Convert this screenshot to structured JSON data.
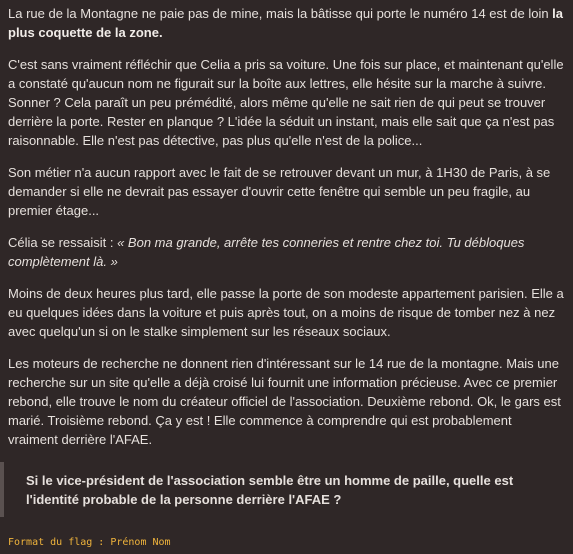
{
  "paragraphs": {
    "p1": {
      "text": "La rue de la Montagne ne paie pas de mine, mais la bâtisse qui porte le numéro 14 est de loin ",
      "bold": "la plus coquette de la zone",
      "tail": "."
    },
    "p2": "C'est sans vraiment réfléchir que Celia a pris sa voiture. Une fois sur place, et maintenant qu'elle a constaté qu'aucun nom ne figurait sur la boîte aux lettres, elle hésite sur la marche à suivre. Sonner ? Cela paraît un peu prémédité, alors même qu'elle ne sait rien de qui peut se trouver derrière la porte. Rester en planque ? L'idée la séduit un instant, mais elle sait que ça n'est pas raisonnable. Elle n'est pas détective, pas plus qu'elle n'est de la police...",
    "p3": "Son métier n'a aucun rapport avec le fait de se retrouver devant un mur, à 1H30 de Paris, à se demander si elle ne devrait pas essayer d'ouvrir cette fenêtre qui semble un peu fragile, au premier étage...",
    "p4": {
      "lead": "Célia se ressaisit : ",
      "italic": "« Bon ma grande, arrête tes conneries et rentre chez toi. Tu débloques complètement là. »"
    },
    "p5": "Moins de deux heures plus tard, elle passe la porte de son modeste appartement parisien. Elle a eu quelques idées dans la voiture et puis après tout, on a moins de risque de tomber nez à nez avec quelqu'un si on le stalke simplement sur les réseaux sociaux.",
    "p6": "Les moteurs de recherche ne donnent rien d'intéressant sur le 14 rue de la montagne. Mais une recherche sur un site qu'elle a déjà croisé lui fournit une information précieuse. Avec ce premier rebond, elle trouve le nom du créateur officiel de l'association. Deuxième rebond. Ok, le gars est marié. Troisième rebond. Ça y est ! Elle commence à comprendre qui est probablement vraiment derrière l'AFAE."
  },
  "question": "Si le vice-président de l'association semble être un homme de paille, quelle est l'identité probable de la personne derrière l'AFAE ?",
  "flag_format": "Format du flag : Prénom Nom",
  "colors": {
    "background": "#2f2727",
    "text": "#e6e0dc",
    "quote_border": "#5a5150",
    "flag": "#f0b43c"
  }
}
